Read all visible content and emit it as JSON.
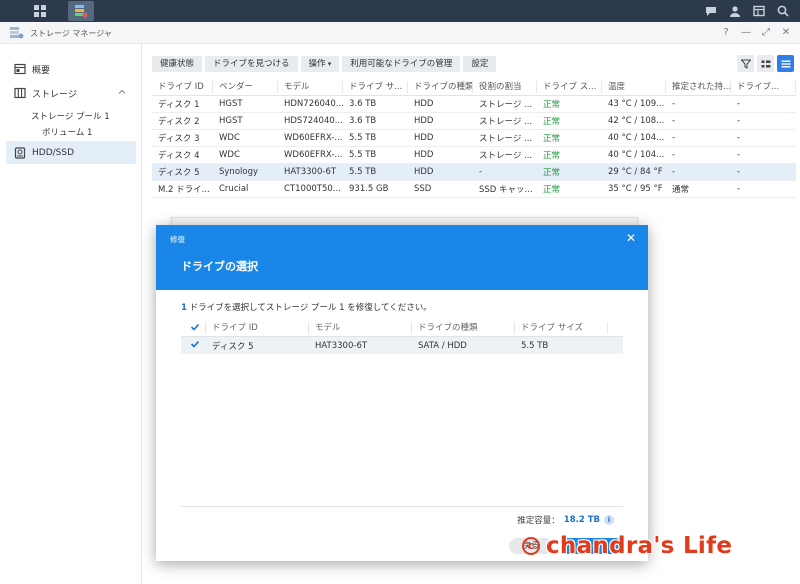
{
  "window": {
    "title": "ストレージ マネージャ",
    "controls": [
      "?",
      "—",
      "⤢",
      "✕"
    ]
  },
  "sidebar": {
    "items": [
      {
        "label": "概要"
      },
      {
        "label": "ストレージ"
      },
      {
        "label": "HDD/SSD"
      }
    ],
    "storage_pool": "ストレージ プール 1",
    "volume": "ボリューム 1"
  },
  "toolbar": {
    "buttons": [
      "健康状態",
      "ドライブを見つける",
      "操作",
      "利用可能なドライブの管理",
      "設定"
    ]
  },
  "drives": {
    "columns": [
      "ドライブ ID",
      "ベンダー",
      "モデル",
      "ドライブ サ...",
      "ドライブの種類",
      "役割の割当",
      "ドライブ ス...",
      "温度",
      "推定された持...",
      "ドライブ..."
    ],
    "rows": [
      [
        "ディスク 1",
        "HGST",
        "HDN726040...",
        "3.6 TB",
        "HDD",
        "ストレージ ...",
        "正常",
        "43 °C / 109...",
        "-",
        "-"
      ],
      [
        "ディスク 2",
        "HGST",
        "HDS724040...",
        "3.6 TB",
        "HDD",
        "ストレージ ...",
        "正常",
        "42 °C / 108...",
        "-",
        "-"
      ],
      [
        "ディスク 3",
        "WDC",
        "WD60EFRX-...",
        "5.5 TB",
        "HDD",
        "ストレージ ...",
        "正常",
        "40 °C / 104...",
        "-",
        "-"
      ],
      [
        "ディスク 4",
        "WDC",
        "WD60EFRX-...",
        "5.5 TB",
        "HDD",
        "ストレージ ...",
        "正常",
        "40 °C / 104...",
        "-",
        "-"
      ],
      [
        "ディスク 5",
        "Synology",
        "HAT3300-6T",
        "5.5 TB",
        "HDD",
        "-",
        "正常",
        "29 °C / 84 °F",
        "-",
        "-"
      ],
      [
        "M.2 ドライ...",
        "Crucial",
        "CT1000T50...",
        "931.5 GB",
        "SSD",
        "SSD キャッ...",
        "正常",
        "35 °C / 95 °F",
        "通常",
        "-"
      ]
    ],
    "selected_index": 4
  },
  "modal": {
    "caption": "修復",
    "title": "ドライブの選択",
    "desc_count": "1",
    "desc_text": " ドライブを選択してストレージ プール 1 を修復してください。",
    "columns": [
      "ドライブ ID",
      "モデル",
      "ドライブの種類",
      "ドライブ サイズ"
    ],
    "rows": [
      [
        "ディスク 5",
        "HAT3300-6T",
        "SATA / HDD",
        "5.5 TB"
      ]
    ],
    "capacity_label": "推定容量：",
    "capacity_value": "18.2 TB",
    "back_label": "戻る",
    "next_label": "次へ"
  },
  "watermark": {
    "symbol": "c",
    "text": "chandra's Life"
  },
  "colors": {
    "accent": "#1a86e8",
    "ok_status": "#1e9e3e",
    "topbar": "#2c3a4b"
  }
}
